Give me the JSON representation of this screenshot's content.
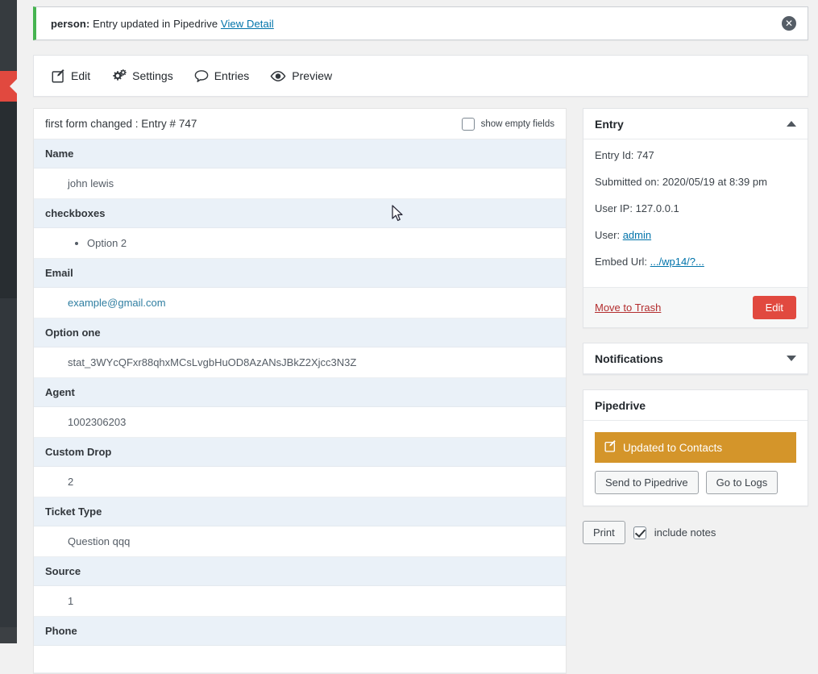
{
  "notice": {
    "prefix": "person:",
    "message": "Entry updated in Pipedrive",
    "link_label": "View Detail",
    "dismiss_icon": "close-circle-icon",
    "accent_color": "#46b450"
  },
  "toolbar": {
    "items": [
      {
        "label": "Edit",
        "icon": "edit-pencil-square-icon"
      },
      {
        "label": "Settings",
        "icon": "gears-icon"
      },
      {
        "label": "Entries",
        "icon": "speech-bubble-icon"
      },
      {
        "label": "Preview",
        "icon": "eye-icon"
      }
    ]
  },
  "entry_card": {
    "title": "first form changed : Entry # 747",
    "show_empty_fields_label": "show empty fields",
    "show_empty_fields_checked": false,
    "fields": [
      {
        "label": "Name",
        "value": "john lewis",
        "type": "text"
      },
      {
        "label": "checkboxes",
        "value": "Option 2",
        "type": "list"
      },
      {
        "label": "Email",
        "value": "example@gmail.com",
        "type": "link"
      },
      {
        "label": "Option one",
        "value": "stat_3WYcQFxr88qhxMCsLvgbHuOD8AzANsJBkZ2Xjcc3N3Z",
        "type": "text"
      },
      {
        "label": "Agent",
        "value": "1002306203",
        "type": "text"
      },
      {
        "label": "Custom Drop",
        "value": "2",
        "type": "text"
      },
      {
        "label": "Ticket Type",
        "value": "Question qqq",
        "type": "text"
      },
      {
        "label": "Source",
        "value": "1",
        "type": "text"
      },
      {
        "label": "Phone",
        "value": "",
        "type": "text"
      }
    ]
  },
  "sidebar": {
    "entry_box": {
      "title": "Entry",
      "collapse_icon": "triangle-up-icon",
      "entry_id_label": "Entry Id: 747",
      "submitted_label": "Submitted on: 2020/05/19 at 8:39 pm",
      "user_ip_label": "User IP: 127.0.0.1",
      "user_prefix": "User:",
      "user_link": "admin",
      "embed_prefix": "Embed Url:",
      "embed_link": ".../wp14/?...",
      "trash_label": "Move to Trash",
      "edit_label": "Edit",
      "edit_color": "#e1493f"
    },
    "notifications_box": {
      "title": "Notifications",
      "collapse_icon": "triangle-down-icon"
    },
    "pipedrive_box": {
      "title": "Pipedrive",
      "status_label": "Updated to Contacts",
      "status_icon": "edit-pencil-square-icon",
      "status_color": "#d4952a",
      "send_label": "Send to Pipedrive",
      "logs_label": "Go to Logs"
    },
    "print_row": {
      "print_label": "Print",
      "include_notes_label": "include notes",
      "include_notes_checked": true
    }
  },
  "chrome": {
    "collapse_flag_icon": "chevron-left-icon",
    "cursor_icon": "arrow-pointer-icon"
  }
}
